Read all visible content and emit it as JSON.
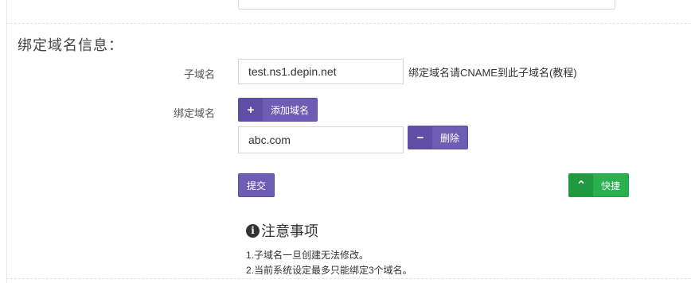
{
  "section_title": "绑定域名信息：",
  "subdomain": {
    "label": "子域名",
    "value": "test.ns1.depin.net",
    "hint": "绑定域名请CNAME到此子域名(教程)"
  },
  "bind": {
    "label": "绑定域名",
    "add_button": "添加域名",
    "domains": [
      {
        "value": "abc.com",
        "delete_label": "删除"
      }
    ]
  },
  "actions": {
    "submit": "提交",
    "quick": "快捷"
  },
  "notice": {
    "title": "注意事项",
    "items": [
      "1.子域名一旦创建无法修改。",
      "2.当前系统设定最多只能绑定3个域名。"
    ]
  },
  "icons": {
    "add": "plus-icon",
    "delete": "minus-icon",
    "quick": "chevron-up-icon",
    "info": "info-circle-icon"
  },
  "colors": {
    "primary": "#6e5db5",
    "success": "#29b04f"
  }
}
